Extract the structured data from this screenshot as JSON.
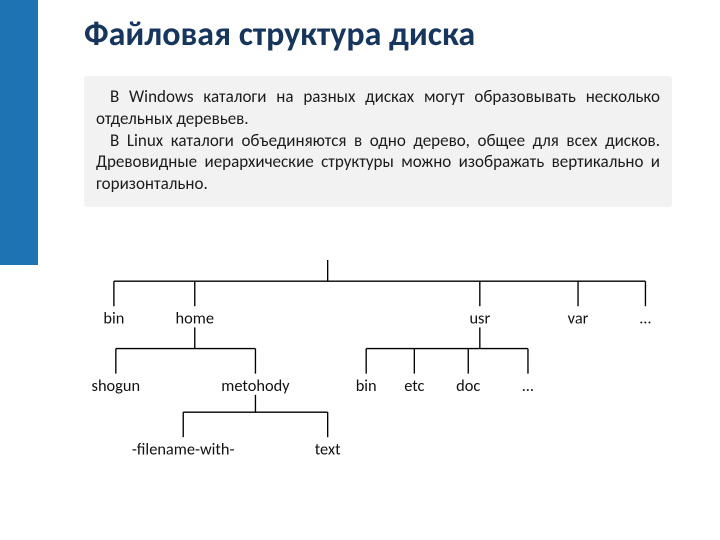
{
  "title": "Файловая структура диска",
  "paragraphs": {
    "p1": "В Windows каталоги на разных дисках могут образовывать несколько отдельных деревьев.",
    "p2": "В Linux каталоги объединяются в одно дерево, общее для всех дисков. Древовидные иерархические структуры можно изображать вертикально и горизонтально."
  },
  "tree": {
    "level1": {
      "bin": "bin",
      "home": "home",
      "usr": "usr",
      "var": "var",
      "more": "…"
    },
    "level2": {
      "shogun": "shogun",
      "metohody": "metohody",
      "usr_bin": "bin",
      "etc": "etc",
      "doc": "doc",
      "usr_more": "…"
    },
    "level3": {
      "filename": "-filename-with-",
      "text": "text"
    }
  },
  "colors": {
    "sidebar": "#1e73b3",
    "heading": "#17365d",
    "box_bg": "#f2f2f2"
  }
}
